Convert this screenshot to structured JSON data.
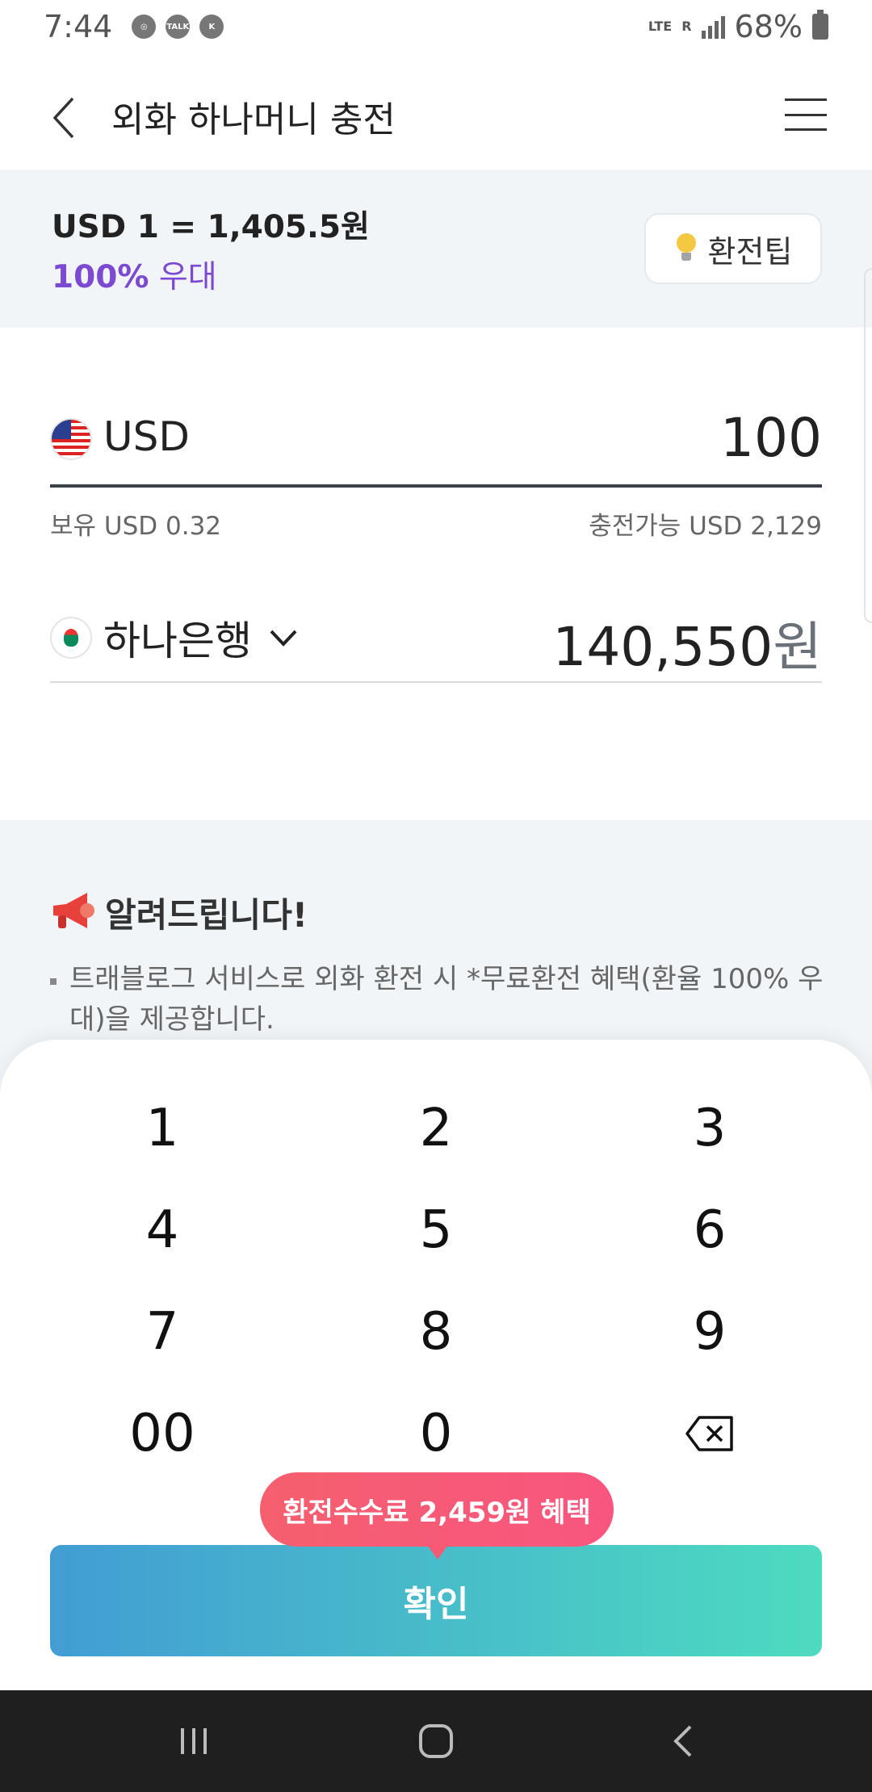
{
  "status_bar": {
    "time": "7:44",
    "network": "LTE",
    "roaming": "R",
    "battery": "68%",
    "icons": [
      "globe-icon",
      "talk-icon",
      "notification-icon"
    ]
  },
  "header": {
    "title": "외화 하나머니 충전",
    "back_icon": "back-arrow-icon",
    "menu_icon": "hamburger-menu-icon"
  },
  "rate": {
    "text": "USD 1 = 1,405.5원",
    "benefit_percent": "100%",
    "benefit_label": " 우대",
    "tip_label": "환전팁"
  },
  "amount": {
    "currency": "USD",
    "value": "100",
    "holding": "보유 USD 0.32",
    "chargeable": "충전가능 USD 2,129"
  },
  "bank": {
    "name": "하나은행",
    "won_amount": "140,550",
    "won_unit": "원"
  },
  "notice": {
    "title": "알려드립니다!",
    "body": "트래블로그 서비스로 외화 환전 시 *무료환전 혜택(환율 100% 우대)을 제공합니다."
  },
  "keypad": {
    "keys": [
      "1",
      "2",
      "3",
      "4",
      "5",
      "6",
      "7",
      "8",
      "9",
      "00",
      "0"
    ]
  },
  "benefit_bubble": "환전수수료 2,459원 혜택",
  "confirm_label": "확인",
  "colors": {
    "accent_purple": "#7c4ad2",
    "bubble_pink": "#f65a75",
    "confirm_start": "#429dd3",
    "confirm_end": "#4ddbc0"
  }
}
